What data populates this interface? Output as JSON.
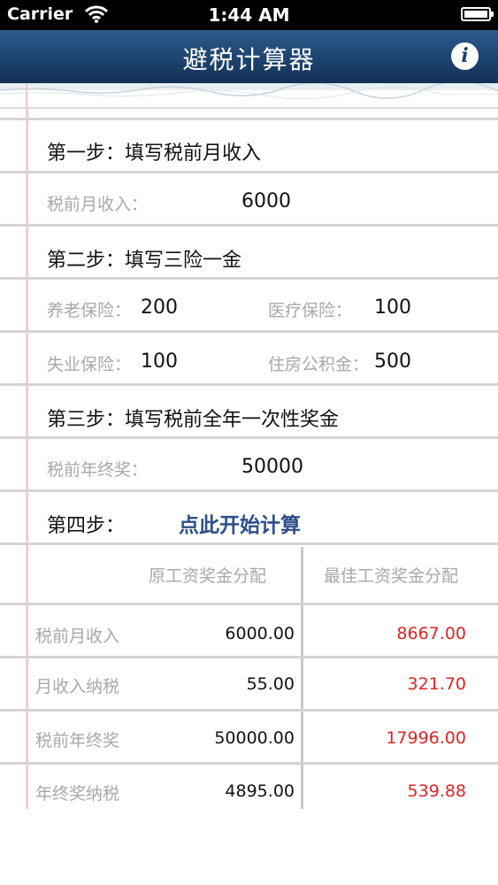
{
  "status_bar": {
    "carrier": "Carrier",
    "time": "1:44 AM"
  },
  "navbar": {
    "title": "避税计算器",
    "info_icon": "i"
  },
  "step1": {
    "title": "第一步：填写税前月收入",
    "label": "税前月收入：",
    "value": "6000"
  },
  "step2": {
    "title": "第二步：填写三险一金",
    "pension_label": "养老保险：",
    "pension_value": "200",
    "medical_label": "医疗保险：",
    "medical_value": "100",
    "unemployment_label": "失业保险：",
    "unemployment_value": "100",
    "housing_label": "住房公积金：",
    "housing_value": "500"
  },
  "step3": {
    "title": "第三步：填写税前全年一次性奖金",
    "label": "税前年终奖：",
    "value": "50000"
  },
  "step4": {
    "title": "第四步：",
    "button": "点此开始计算"
  },
  "results": {
    "headers": [
      "原工资奖金分配",
      "最佳工资奖金分配"
    ],
    "rows": [
      {
        "label": "税前月收入",
        "original": "6000.00",
        "best": "8667.00"
      },
      {
        "label": "月收入纳税",
        "original": "55.00",
        "best": "321.70"
      },
      {
        "label": "税前年终奖",
        "original": "50000.00",
        "best": "17996.00"
      },
      {
        "label": "年终奖纳税",
        "original": "4895.00",
        "best": "539.88"
      }
    ]
  },
  "colors": {
    "nav": "#1c416c",
    "accent_button": "#2c4f8a",
    "best_value": "#e02424"
  }
}
